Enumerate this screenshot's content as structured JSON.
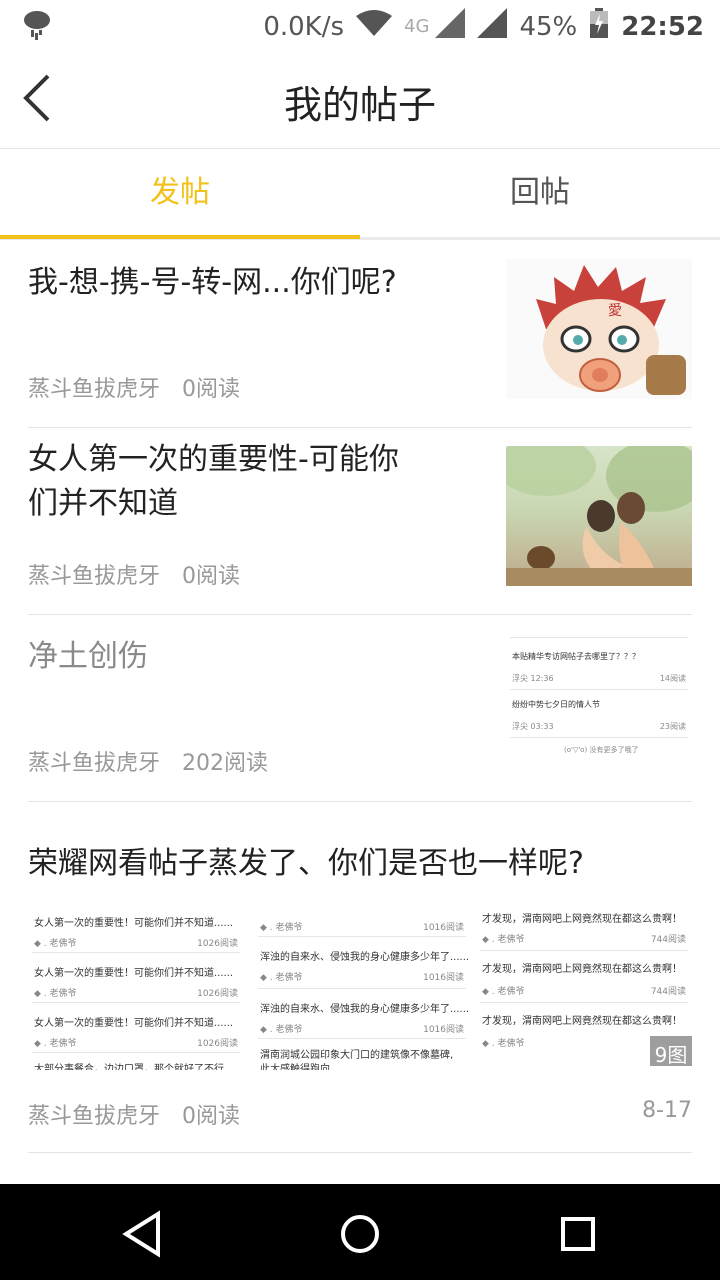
{
  "status_bar": {
    "speed": "0.0K/s",
    "network": "4G",
    "battery": "45%",
    "time": "22:52"
  },
  "header": {
    "title": "我的帖子"
  },
  "tabs": [
    {
      "label": "发帖"
    },
    {
      "label": "回帖"
    }
  ],
  "posts": [
    {
      "title": "我-想-携-号-转-网...你们呢?",
      "author": "蒸斗鱼拔虎牙",
      "reads": "0阅读"
    },
    {
      "title_line1": "女人第一次的重要性-可能你",
      "title_line2": "们并不知道",
      "author": "蒸斗鱼拔虎牙",
      "reads": "0阅读"
    },
    {
      "title": "净土创伤",
      "author": "蒸斗鱼拔虎牙",
      "reads": "202阅读",
      "thumb_lines": [
        "本贴精华专访网帖子去哪里了？？？",
        "浮尖 12:36",
        "14阅读",
        "纷纷中势七夕日的情人节",
        "浮尖 03:33",
        "23阅读",
        "(o'▽'o) 没有更多了哦了"
      ]
    },
    {
      "title": "荣耀网看帖子蒸发了、你们是否也一样呢?",
      "author": "蒸斗鱼拔虎牙",
      "reads": "0阅读",
      "date": "8-17",
      "image_count": "9图",
      "thumbs": [
        {
          "lines": [
            "女人第一次的重要性！可能你们并不知道......",
            "女人第一次的重要性！可能你们并不知道......",
            "女人第一次的重要性！可能你们并不知道......",
            "大部分事餐合，边边口罩，那个就好了不行"
          ],
          "author": "◆ . 老佛爷",
          "reads": "1026阅读"
        },
        {
          "lines": [
            "浑浊的自来水、侵蚀我的身心健康多少年了......",
            "浑浊的自来水、侵蚀我的身心健康多少年了......",
            "渭南润城公园印象大门口的建筑像不像墓碑,",
            "此大感触得跑向"
          ],
          "author": "◆ . 老佛爷",
          "reads": "1016阅读"
        },
        {
          "lines": [
            "才发现，渭南网吧上网竟然现在都这么贵啊！",
            "才发现，渭南网吧上网竟然现在都这么贵啊！",
            "才发现，渭南网吧上网竟然现在都这么贵啊！"
          ],
          "author": "◆ . 老佛爷",
          "reads": "744阅读"
        }
      ]
    }
  ]
}
